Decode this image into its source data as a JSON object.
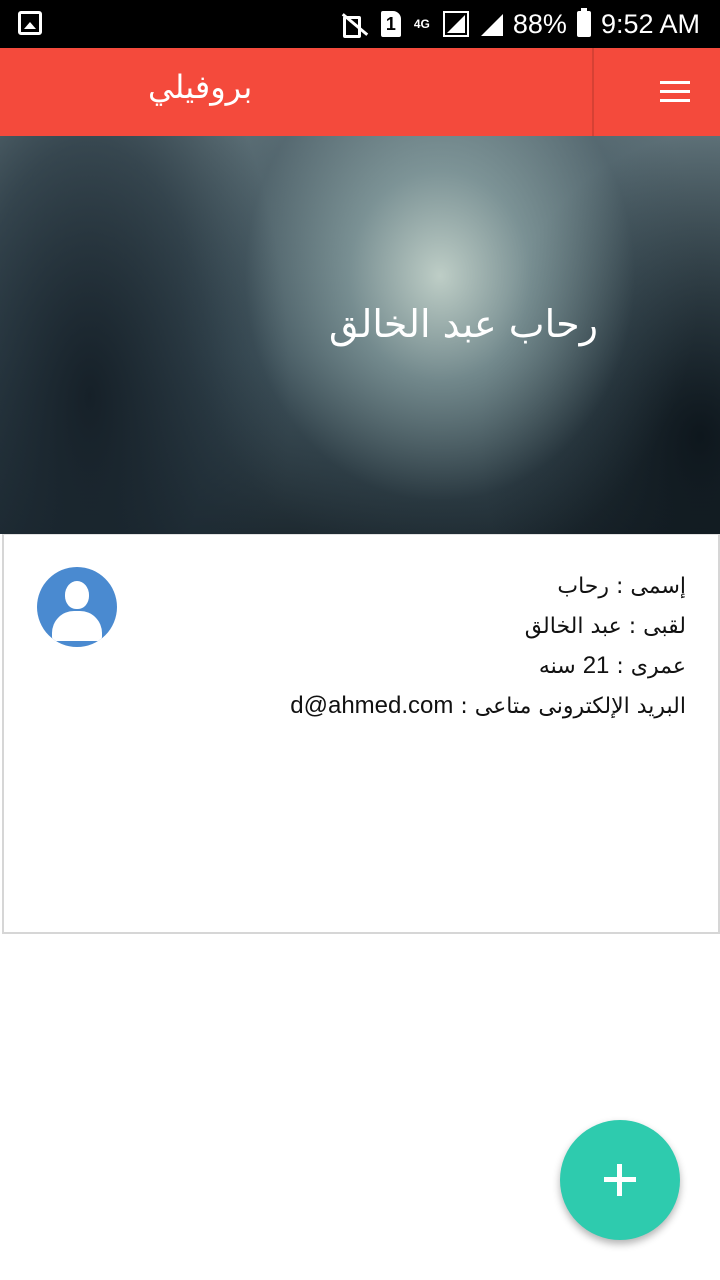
{
  "status_bar": {
    "battery_percent": "88%",
    "time": "9:52 AM",
    "network_type": "4G",
    "sim_slot": "1",
    "icons": [
      "gallery-icon",
      "mute-icon",
      "sim-icon",
      "signal-icon",
      "battery-icon"
    ]
  },
  "app_bar": {
    "title": "بروفيلي",
    "menu_icon": "hamburger-menu-icon",
    "color": "#f44a3c"
  },
  "header": {
    "display_name": "رحاب عبد الخالق"
  },
  "profile": {
    "avatar_icon": "user-avatar-icon",
    "name_label": "إسمى : ",
    "name_value": "رحاب",
    "surname_label": "لقبى : ",
    "surname_value": "عبد الخالق",
    "age_label": "عمرى : ",
    "age_value": "21",
    "age_unit": " سنه",
    "email_label": "البريد الإلكترونى متاعى : ",
    "email_value": "d@ahmed.com"
  },
  "fab": {
    "icon": "plus-icon",
    "color": "#2ecbae"
  }
}
